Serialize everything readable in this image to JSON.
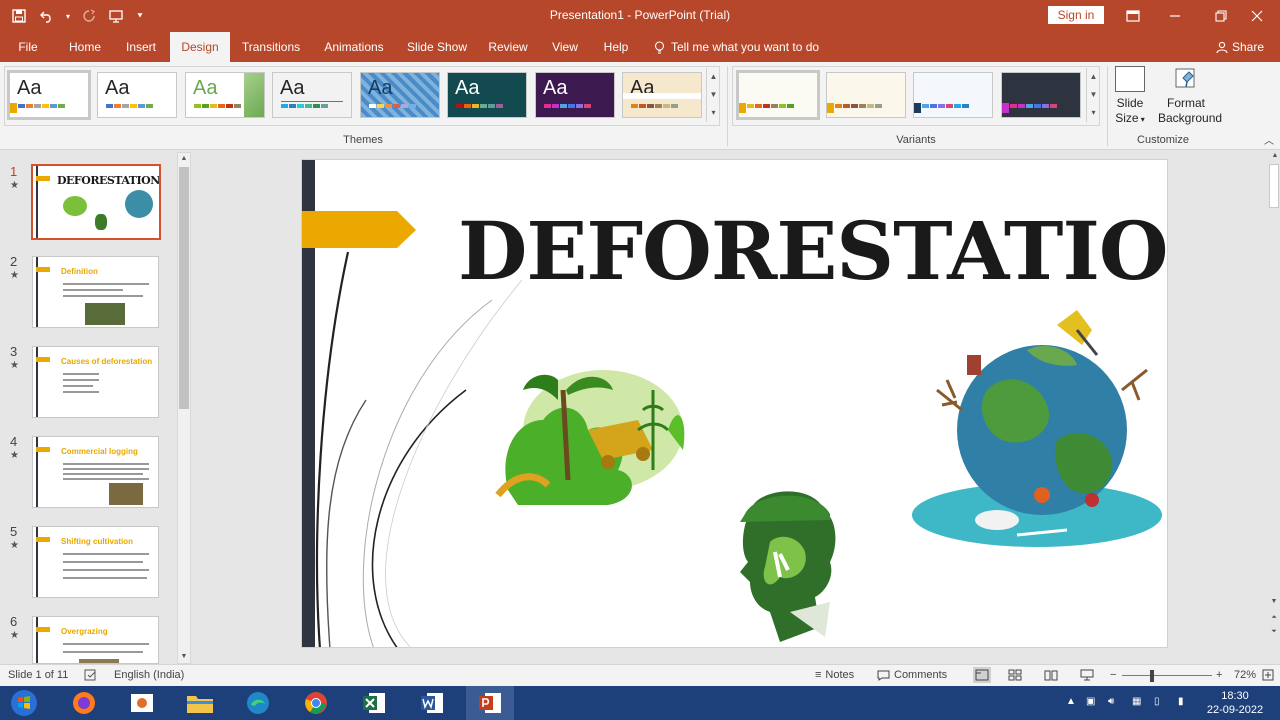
{
  "titlebar": {
    "title": "Presentation1  -  PowerPoint (Trial)",
    "sign_in": "Sign in"
  },
  "tabs": [
    "File",
    "Home",
    "Insert",
    "Design",
    "Transitions",
    "Animations",
    "Slide Show",
    "Review",
    "View",
    "Help"
  ],
  "active_tab": "Design",
  "tell_me": "Tell me what you want to do",
  "share": "Share",
  "ribbon": {
    "themes_label": "Themes",
    "variants_label": "Variants",
    "customize_label": "Customize",
    "theme_sample": "Aa",
    "slide_size": [
      "Slide",
      "Size"
    ],
    "format_background": [
      "Format",
      "Background"
    ]
  },
  "slides": [
    {
      "num": "1",
      "title": "DEFORESTATION"
    },
    {
      "num": "2",
      "title": "Definition"
    },
    {
      "num": "3",
      "title": "Causes of deforestation"
    },
    {
      "num": "4",
      "title": "Commercial logging"
    },
    {
      "num": "5",
      "title": "Shifting cultivation"
    },
    {
      "num": "6",
      "title": "Overgrazing"
    }
  ],
  "slide_main": {
    "title": "DEFORESTATION"
  },
  "status": {
    "slide_indicator": "Slide 1 of 11",
    "language": "English (India)",
    "notes": "Notes",
    "comments": "Comments",
    "zoom": "72%"
  },
  "taskbar": {
    "time": "18:30",
    "date": "22-09-2022"
  },
  "colors": {
    "accent": "#b7472a",
    "flag": "#eaa800",
    "dark_bar": "#2e3440"
  }
}
